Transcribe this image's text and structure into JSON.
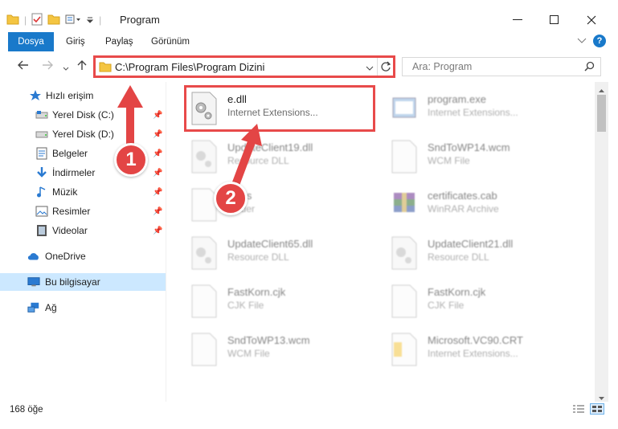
{
  "window": {
    "title": "Program"
  },
  "ribbon": {
    "tabs": [
      "Dosya",
      "Giriş",
      "Paylaş",
      "Görünüm"
    ]
  },
  "navigation": {
    "address": "C:\\Program Files\\Program Dizini",
    "search_placeholder": "Ara: Program"
  },
  "sidebar": {
    "quick_access": "Hızlı erişim",
    "items": [
      {
        "label": "Yerel Disk (C:)",
        "icon": "drive-icon",
        "pinned": true
      },
      {
        "label": "Yerel Disk (D:)",
        "icon": "drive-icon",
        "pinned": true
      },
      {
        "label": "Belgeler",
        "icon": "documents-icon",
        "pinned": true
      },
      {
        "label": "İndirmeler",
        "icon": "downloads-icon",
        "pinned": true
      },
      {
        "label": "Müzik",
        "icon": "music-icon",
        "pinned": true
      },
      {
        "label": "Resimler",
        "icon": "pictures-icon",
        "pinned": true
      },
      {
        "label": "Videolar",
        "icon": "videos-icon",
        "pinned": true
      }
    ],
    "onedrive": "OneDrive",
    "this_pc": "Bu bilgisayar",
    "network": "Ağ"
  },
  "files": [
    {
      "name": "e.dll",
      "desc": "Internet Extensions...",
      "icon": "dll-gear-icon",
      "highlighted": true
    },
    {
      "name": "program.exe",
      "desc": "Internet Extensions...",
      "icon": "exe-icon",
      "highlighted": false
    },
    {
      "name": "UpdateClient19.dll",
      "desc": "Resource DLL",
      "icon": "dll-gear-icon",
      "highlighted": false
    },
    {
      "name": "SndToWP14.wcm",
      "desc": "WCM File",
      "icon": "blank-file-icon",
      "highlighted": false
    },
    {
      "name": "Tools",
      "desc": "Folder",
      "icon": "blank-file-icon",
      "highlighted": false
    },
    {
      "name": "certificates.cab",
      "desc": "WinRAR Archive",
      "icon": "winrar-icon",
      "highlighted": false
    },
    {
      "name": "UpdateClient65.dll",
      "desc": "Resource DLL",
      "icon": "dll-gear-icon",
      "highlighted": false
    },
    {
      "name": "UpdateClient21.dll",
      "desc": "Resource DLL",
      "icon": "dll-gear-icon",
      "highlighted": false
    },
    {
      "name": "FastKorn.cjk",
      "desc": "CJK File",
      "icon": "blank-file-icon",
      "highlighted": false
    },
    {
      "name": "FastKorn.cjk",
      "desc": "CJK File",
      "icon": "blank-file-icon",
      "highlighted": false
    },
    {
      "name": "SndToWP13.wcm",
      "desc": "WCM File",
      "icon": "blank-file-icon",
      "highlighted": false
    },
    {
      "name": "Microsoft.VC90.CRT",
      "desc": "Internet Extensions...",
      "icon": "manifest-icon",
      "highlighted": false
    }
  ],
  "status": {
    "item_count": "168 öğe"
  },
  "annotations": {
    "step1": "1",
    "step2": "2"
  },
  "colors": {
    "accent": "#1979ca",
    "highlight": "#e84a4a",
    "selected": "#cce8ff"
  }
}
